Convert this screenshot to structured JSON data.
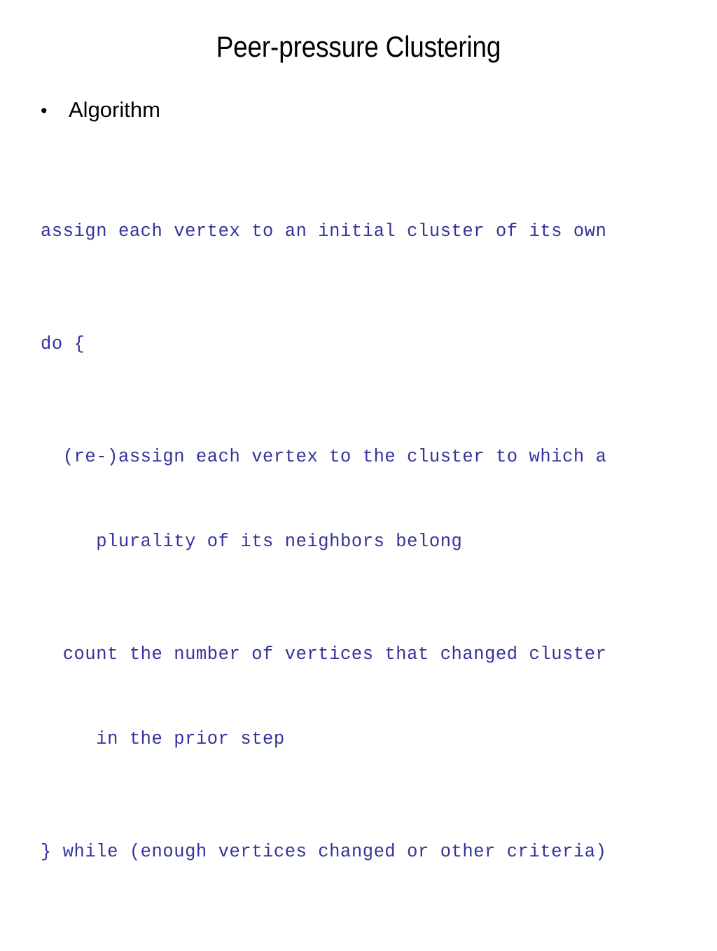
{
  "slide": {
    "title": "Peer-pressure Clustering",
    "background_color": "#ffffff",
    "title_color": "#000000",
    "code_color": "#33339a"
  },
  "body": {
    "bullets": [
      {
        "glyph": "•",
        "label": "Algorithm"
      }
    ],
    "code": {
      "lines": [
        {
          "indent": 0,
          "text": "assign each vertex to an initial cluster of its own",
          "continuation": null
        },
        {
          "indent": 0,
          "text": "do {",
          "continuation": null
        },
        {
          "indent": 2,
          "text": "(re-)assign each vertex to the cluster to which a",
          "continuation": "plurality of its neighbors belong",
          "continuation_indent": 5
        },
        {
          "indent": 2,
          "text": "count the number of vertices that changed cluster",
          "continuation": "in the prior step",
          "continuation_indent": 5
        },
        {
          "indent": 0,
          "text": "} while (enough vertices changed or other criteria)",
          "continuation": null
        }
      ]
    }
  }
}
